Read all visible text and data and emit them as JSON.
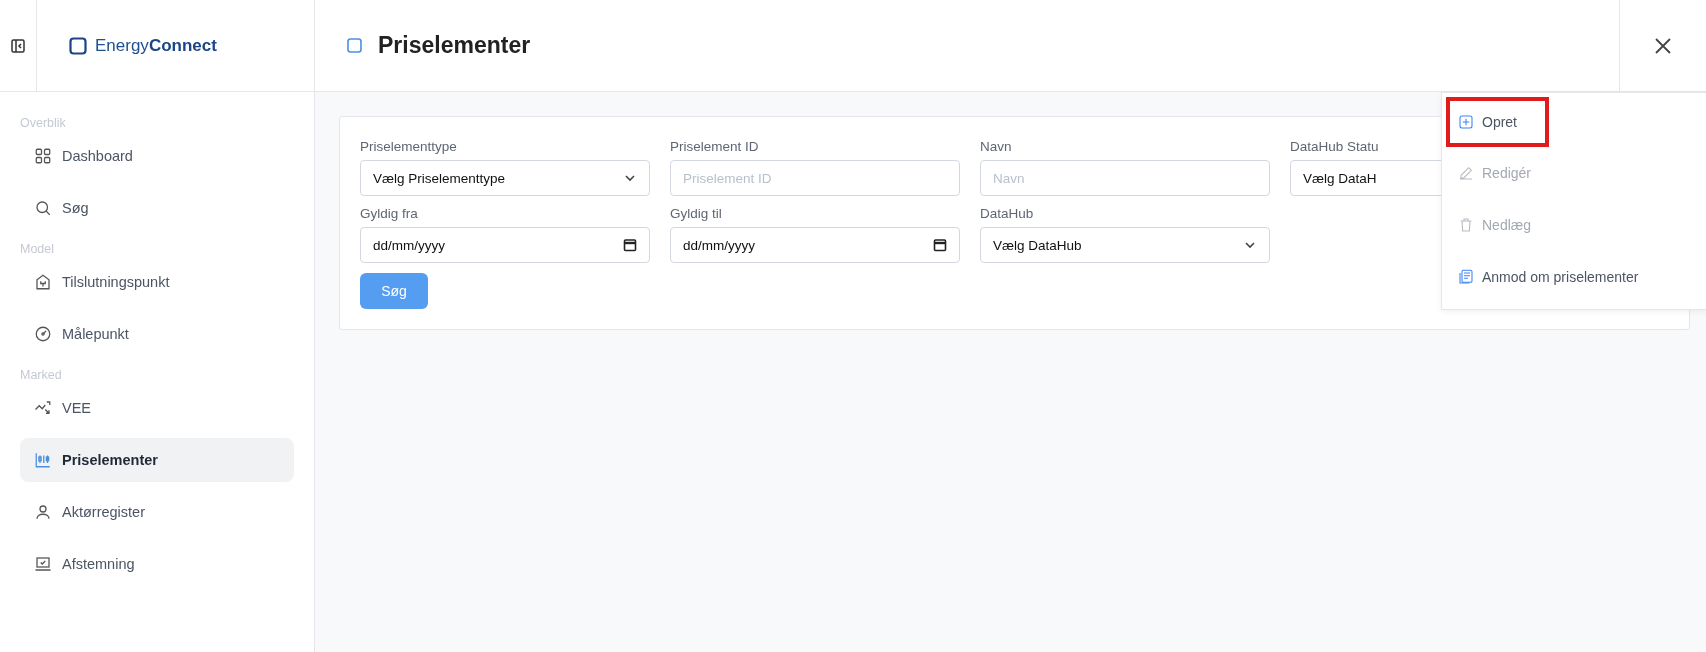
{
  "brand": {
    "name_part1": "Energy",
    "name_part2": "Connect"
  },
  "header": {
    "title": "Priselementer"
  },
  "sidebar": {
    "sections": [
      {
        "title": "Overblik",
        "items": [
          {
            "label": "Dashboard",
            "selected": false
          },
          {
            "label": "Søg",
            "selected": false
          }
        ]
      },
      {
        "title": "Model",
        "items": [
          {
            "label": "Tilslutningspunkt",
            "selected": false
          },
          {
            "label": "Målepunkt",
            "selected": false
          }
        ]
      },
      {
        "title": "Marked",
        "items": [
          {
            "label": "VEE",
            "selected": false
          },
          {
            "label": "Priselementer",
            "selected": true
          },
          {
            "label": "Aktørregister",
            "selected": false
          },
          {
            "label": "Afstemning",
            "selected": false
          }
        ]
      }
    ]
  },
  "filters": {
    "fields": [
      {
        "kind": "select",
        "label": "Priselementtype",
        "value": "Vælg Priselementtype"
      },
      {
        "kind": "text",
        "label": "Priselement ID",
        "placeholder": "Priselement ID"
      },
      {
        "kind": "text",
        "label": "Navn",
        "placeholder": "Navn"
      },
      {
        "kind": "covered",
        "label": "DataHub Statu",
        "value": "Vælg DataH"
      },
      {
        "kind": "date",
        "label": "Gyldig fra",
        "value": "dd/mm/yyyy"
      },
      {
        "kind": "date",
        "label": "Gyldig til",
        "value": "dd/mm/yyyy"
      },
      {
        "kind": "select",
        "label": "DataHub",
        "value": "Vælg DataHub"
      }
    ],
    "search_button": "Søg"
  },
  "action_menu": {
    "items": [
      {
        "label": "Opret",
        "disabled": false,
        "highlighted": true
      },
      {
        "label": "Redigér",
        "disabled": true,
        "highlighted": false
      },
      {
        "label": "Nedlæg",
        "disabled": true,
        "highlighted": false
      },
      {
        "label": "Anmod om priselementer",
        "disabled": false,
        "highlighted": false
      }
    ]
  }
}
